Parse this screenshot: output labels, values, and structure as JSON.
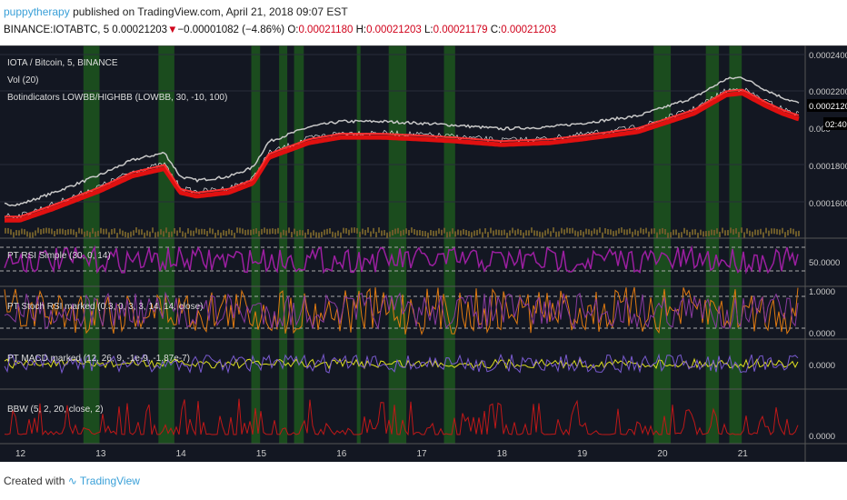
{
  "header": {
    "user": "puppytherapy",
    "published": "published on TradingView.com, April 21, 2018 09:07 EST",
    "symbol": "BINANCE:IOTABTC, 5",
    "last": "0.00021203",
    "change": "−0.00001082 (−4.86%)",
    "o_label": "O:",
    "o": "0.00021180",
    "h_label": "H:",
    "h": "0.00021203",
    "l_label": "L:",
    "l": "0.00021179",
    "c_label": "C:",
    "c": "0.00021203"
  },
  "panes": {
    "main_title": "IOTA / Bitcoin, 5, BINANCE",
    "vol": "Vol (20)",
    "bot": "Botindicators LOWBB/HIGHBB (LOWBB, 30, -10, 100)",
    "rsi": "PT RSI Simple (30, 0, 14)",
    "stoch": "PT Stoch RSI marked (0.3, 0, 3, 3, 14, 14, close)",
    "macd": "PT MACD marked (12, 26, 9, -1e-9, -1.87e-7)",
    "bbw": "BBW (5, 2, 20, close, 2)"
  },
  "axis": {
    "price_ticks": [
      "0.00024000",
      "0.00022000",
      "0.00018000",
      "0.00016000"
    ],
    "current_price": "0.00021203",
    "countdown": "02:40",
    "partial_label": "0.000",
    "rsi_tick": "50.0000",
    "stoch_ticks": [
      "1.0000",
      "0.0000"
    ],
    "macd_tick": "0.0000",
    "bbw_tick": "0.0000",
    "days": [
      "12",
      "13",
      "14",
      "15",
      "16",
      "17",
      "18",
      "19",
      "20",
      "21"
    ]
  },
  "colors": {
    "bg": "#131722",
    "price": "#e01010",
    "band": "#c8c8c8",
    "green": "#1e5a1e",
    "rsi": "#9b1fa0",
    "stoch": "#e07a10",
    "macd_yellow": "#e0e020",
    "bbw": "#c01818"
  },
  "chart_data": {
    "type": "line",
    "title": "IOTA / Bitcoin, 5, BINANCE",
    "x_unit": "day (April 2018)",
    "x": [
      12.0,
      12.4,
      13.0,
      13.4,
      13.8,
      14.0,
      14.2,
      14.6,
      14.9,
      15.1,
      15.6,
      16.0,
      16.5,
      17.0,
      17.4,
      18.0,
      18.6,
      19.0,
      19.7,
      20.4,
      20.8,
      21.0,
      21.3,
      21.5,
      21.7
    ],
    "price": [
      0.000152,
      0.000158,
      0.000168,
      0.000176,
      0.00018,
      0.000167,
      0.000165,
      0.000167,
      0.000172,
      0.000186,
      0.000194,
      0.000197,
      0.000197,
      0.000196,
      0.000195,
      0.000193,
      0.000194,
      0.000196,
      0.0002,
      0.00021,
      0.00022,
      0.000221,
      0.000214,
      0.00021,
      0.000207
    ],
    "ylim": [
      0.00015,
      0.000245
    ]
  },
  "footer": {
    "created": "Created with",
    "brand": "TradingView"
  }
}
